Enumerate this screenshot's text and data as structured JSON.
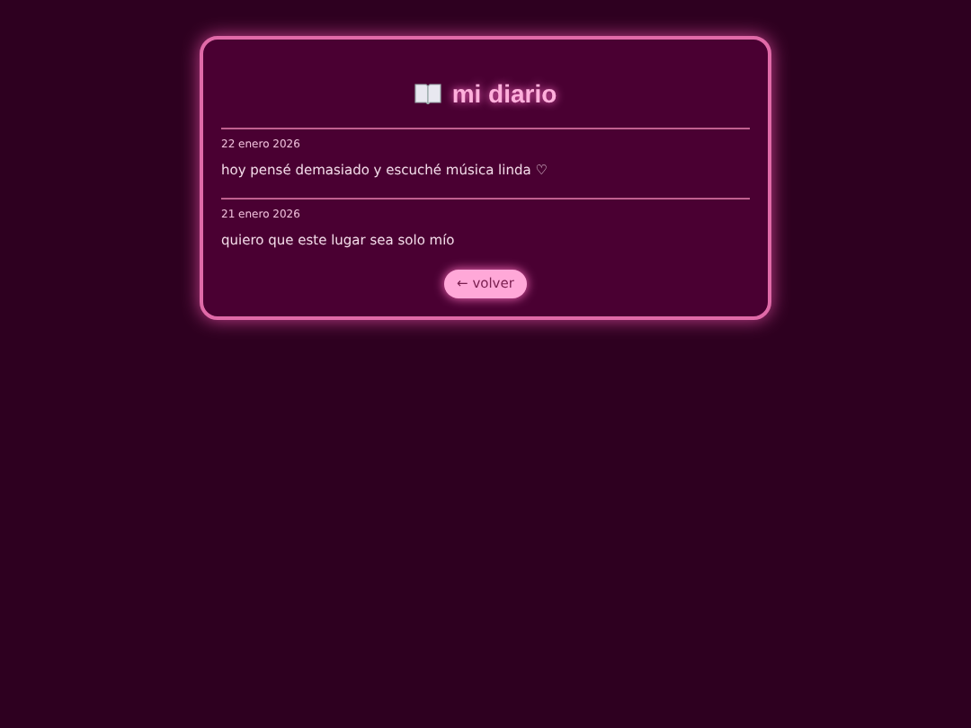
{
  "title": "mi diario",
  "entries": [
    {
      "date": "22 enero 2026",
      "text": "hoy pensé demasiado y escuché música linda ♡"
    },
    {
      "date": "21 enero 2026",
      "text": "quiero que este lugar sea solo mío"
    }
  ],
  "back_button": "← volver"
}
